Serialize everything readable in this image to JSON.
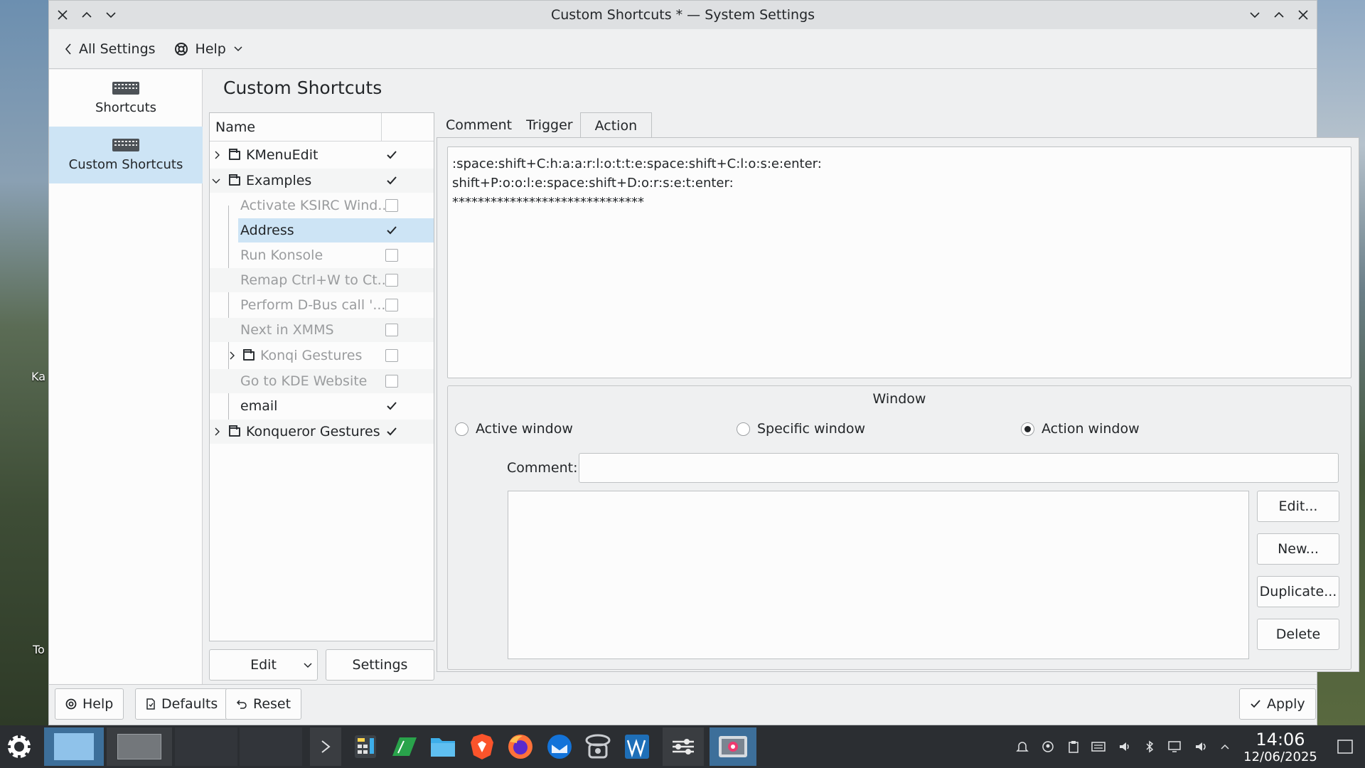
{
  "window": {
    "title": "Custom Shortcuts * — System Settings"
  },
  "desktop": {
    "labels": [
      "Ka",
      "To"
    ]
  },
  "toolbar": {
    "back_label": "All Settings",
    "help_label": "Help"
  },
  "sidebar": {
    "items": [
      {
        "label": "Shortcuts",
        "icon": "keyboard-icon"
      },
      {
        "label": "Custom Shortcuts",
        "icon": "keyboard-icon",
        "active": true
      }
    ]
  },
  "page": {
    "title": "Custom Shortcuts"
  },
  "tree": {
    "header": "Name",
    "rows": [
      {
        "label": "KMenuEdit",
        "checked": true,
        "type": "folder",
        "expanded": false
      },
      {
        "label": "Examples",
        "checked": true,
        "type": "folder",
        "expanded": true
      },
      {
        "label": "Activate KSIRC Wind...",
        "checked": false,
        "dim": true
      },
      {
        "label": "Address",
        "checked": true,
        "selected": true
      },
      {
        "label": "Run Konsole",
        "checked": false,
        "dim": true
      },
      {
        "label": "Remap Ctrl+W to Ct...",
        "checked": false,
        "dim": true
      },
      {
        "label": "Perform D-Bus call '...",
        "checked": false,
        "dim": true
      },
      {
        "label": "Next in XMMS",
        "checked": false,
        "dim": true
      },
      {
        "label": "Konqi Gestures",
        "checked": false,
        "dim": true,
        "type": "folder",
        "expanded": false
      },
      {
        "label": "Go to KDE Website",
        "checked": false,
        "dim": true
      },
      {
        "label": "email",
        "checked": true
      },
      {
        "label": "Konqueror Gestures",
        "checked": true,
        "type": "folder",
        "expanded": false
      }
    ],
    "edit_button": "Edit",
    "settings_button": "Settings"
  },
  "tabs": [
    "Comment",
    "Trigger",
    "Action"
  ],
  "action": {
    "text": ":space:shift+C:h:a:a:r:l:o:t:t:e:space:shift+C:l:o:s:e:enter:\nshift+P:o:o:l:e:space:shift+D:o:r:s:e:t:enter:\n******************************",
    "window_group_title": "Window",
    "radios": [
      {
        "label": "Active window",
        "checked": false
      },
      {
        "label": "Specific window",
        "checked": false
      },
      {
        "label": "Action window",
        "checked": true
      }
    ],
    "comment_label": "Comment:",
    "comment_value": "",
    "buttons": [
      "Edit...",
      "New...",
      "Duplicate...",
      "Delete"
    ]
  },
  "bottom": {
    "help": "Help",
    "defaults": "Defaults",
    "reset": "Reset",
    "apply": "Apply"
  },
  "taskbar": {
    "time": "14:06",
    "date": "12/06/2025"
  },
  "colors": {
    "selection": "#cde4f5",
    "taskbar": "#2b2e32",
    "window_bg": "#eff0f1"
  }
}
